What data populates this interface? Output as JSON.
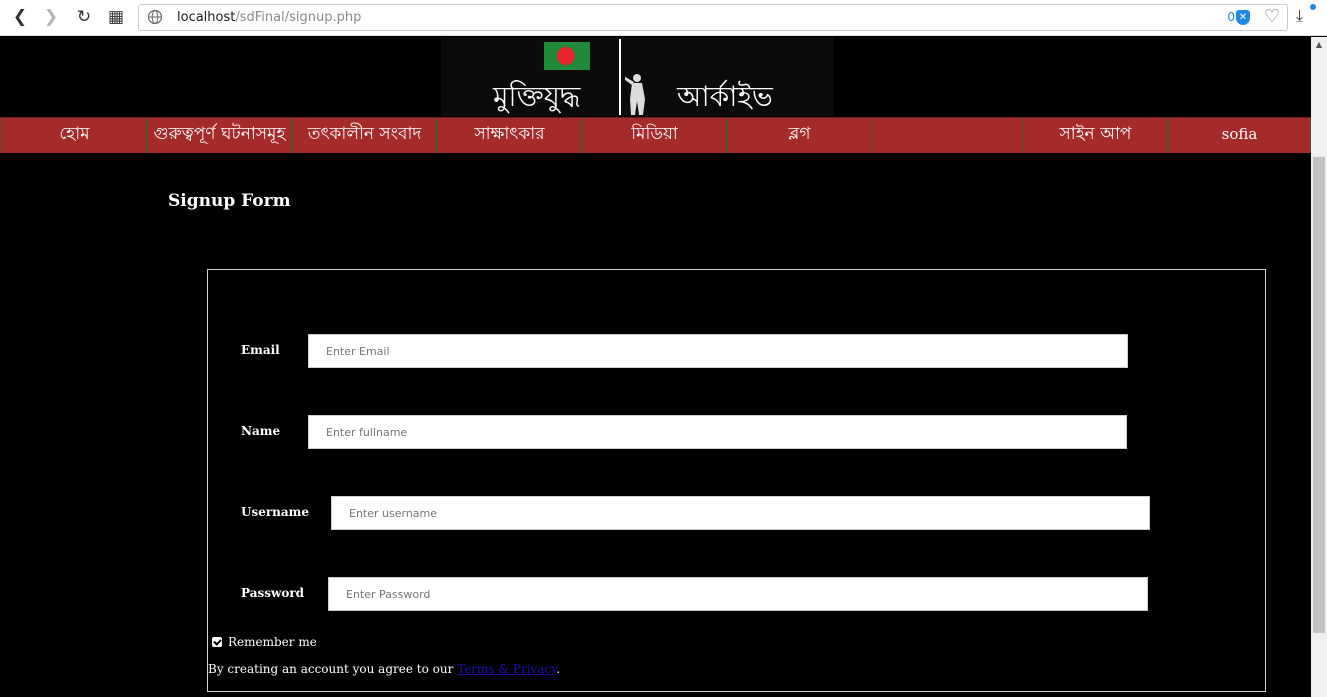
{
  "browser": {
    "url_host": "localhost",
    "url_path": "/sdFinal/signup.php",
    "extension_count": "0"
  },
  "banner": {
    "title_left": "মুক্তিযুদ্ধ",
    "title_right": "আর্কাইভ"
  },
  "menu": {
    "items": [
      {
        "label": "হোম"
      },
      {
        "label": "গুরুত্বপূর্ণ ঘটনাসমূহ"
      },
      {
        "label": "তৎকালীন সংবাদ"
      },
      {
        "label": "সাক্ষাৎকার"
      },
      {
        "label": "মিডিয়া"
      },
      {
        "label": "ব্লগ"
      },
      {
        "label": "সাইন আপ"
      },
      {
        "label": "sofia"
      }
    ]
  },
  "page": {
    "title": "Signup Form"
  },
  "form": {
    "email_label": "Email",
    "email_placeholder": "Enter Email",
    "name_label": "Name",
    "name_placeholder": "Enter fullname",
    "username_label": "Username",
    "username_placeholder": "Enter username",
    "password_label": "Password",
    "password_placeholder": "Enter Password",
    "remember_label": "Remember me",
    "remember_checked": true,
    "terms_prefix": "By creating an account you agree to our ",
    "terms_link": "Terms & Privacy",
    "terms_suffix": "."
  },
  "colors": {
    "menu_bg": "#a52a2a",
    "page_bg": "#000000",
    "flag_green": "#1e8a3a",
    "flag_red": "#e8262b",
    "link": "#1a0dab"
  }
}
